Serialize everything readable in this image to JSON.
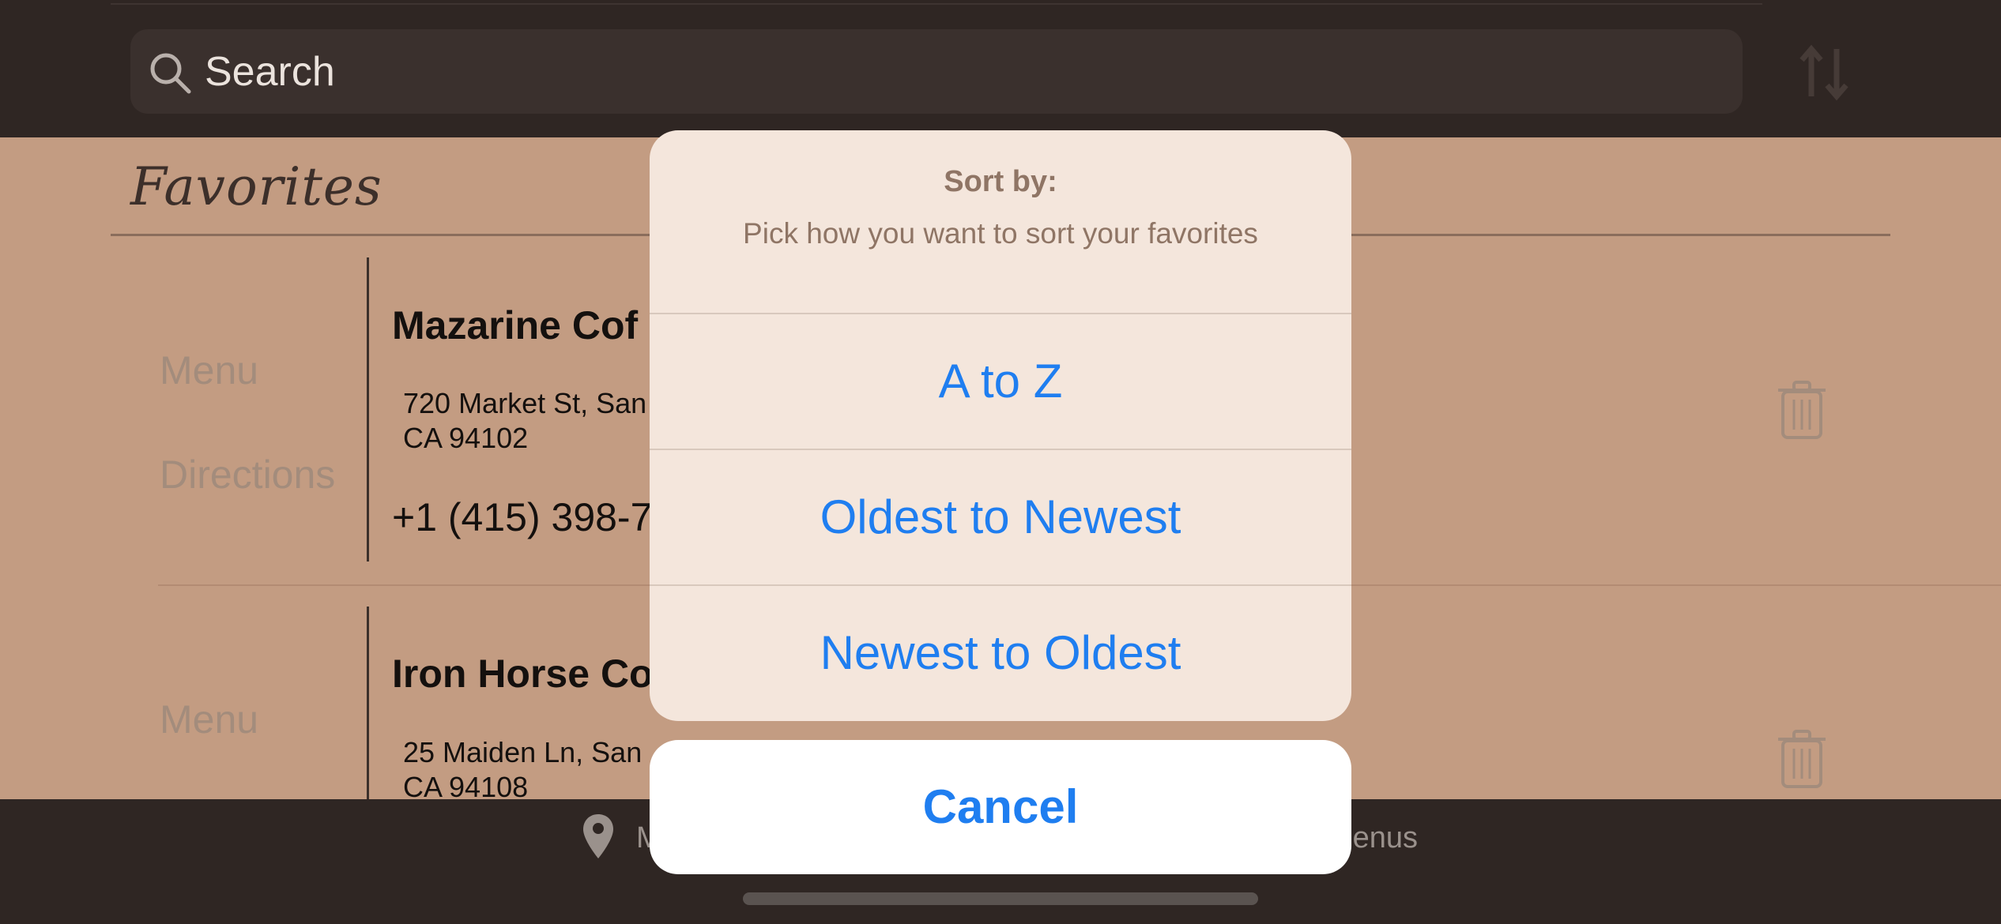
{
  "search": {
    "placeholder": "Search",
    "icon": "search-icon"
  },
  "header": {
    "sort_icon": "sort-arrows-icon"
  },
  "favorites": {
    "title": "Favorites",
    "items": [
      {
        "menu_label": "Menu",
        "directions_label": "Directions",
        "name": "Mazarine Cof",
        "address_line1": "720 Market St, San",
        "address_line2": "CA 94102",
        "phone": "+1 (415) 398-7",
        "delete_icon": "trash-icon"
      },
      {
        "menu_label": "Menu",
        "name": "Iron Horse Co",
        "address_line1": "25 Maiden Ln, San",
        "address_line2": "CA 94108",
        "delete_icon": "trash-icon"
      }
    ]
  },
  "tab_bar": {
    "left_label": "M",
    "left_icon": "map-pin-icon",
    "right_label": "Menus"
  },
  "action_sheet": {
    "title": "Sort by:",
    "message": "Pick how you want to sort your favorites",
    "options": [
      "A to Z",
      "Oldest to Newest",
      "Newest to Oldest"
    ],
    "cancel_label": "Cancel"
  },
  "colors": {
    "accent": "#1f7ef0",
    "background": "#c39c82",
    "bar": "#2f2623",
    "sheet": "#f4e6dc"
  }
}
